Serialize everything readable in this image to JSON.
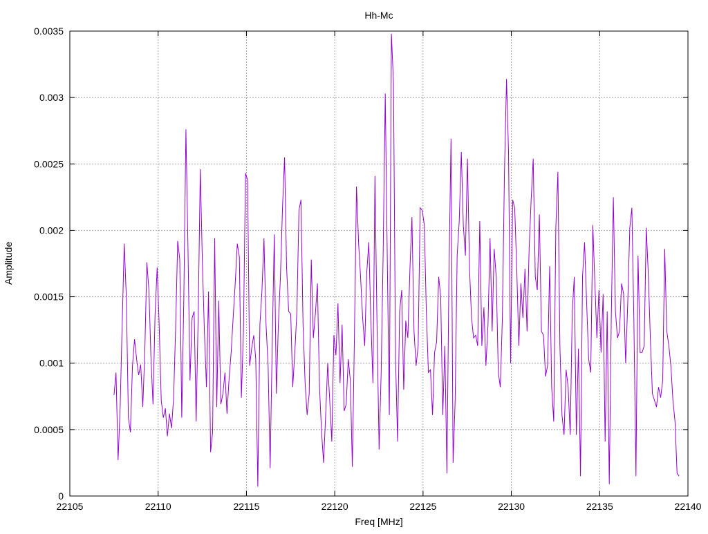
{
  "chart_data": {
    "type": "line",
    "title": "Hh-Mc",
    "xlabel": "Freq [MHz]",
    "ylabel": "Amplitude",
    "xlim": [
      22105,
      22140
    ],
    "ylim": [
      0,
      0.0035
    ],
    "xticks": [
      "22105",
      "22110",
      "22115",
      "22120",
      "22125",
      "22130",
      "22135",
      "22140"
    ],
    "xtick_values": [
      22105,
      22110,
      22115,
      22120,
      22125,
      22130,
      22135,
      22140
    ],
    "yticks": [
      "0",
      "0.0005",
      "0.001",
      "0.0015",
      "0.002",
      "0.0025",
      "0.003",
      "0.0035"
    ],
    "ytick_values": [
      0,
      0.0005,
      0.001,
      0.0015,
      0.002,
      0.0025,
      0.003,
      0.0035
    ],
    "grid": true,
    "legend": "none",
    "series": [
      {
        "name": "Hh-Mc",
        "color": "#9400d3",
        "x_range": [
          22107.5,
          22139.5
        ],
        "values": [
          0.00076,
          0.00093,
          0.00027,
          0.00067,
          0.00129,
          0.0019,
          0.0015,
          0.00059,
          0.00048,
          0.00098,
          0.00118,
          0.00103,
          0.00091,
          0.00099,
          0.00067,
          0.00108,
          0.00176,
          0.00155,
          0.00103,
          0.00069,
          0.00137,
          0.00172,
          0.00129,
          0.00072,
          0.00059,
          0.00066,
          0.00045,
          0.00062,
          0.00051,
          0.00074,
          0.00126,
          0.00192,
          0.00178,
          0.00059,
          0.0015,
          0.00276,
          0.00186,
          0.00087,
          0.00134,
          0.00139,
          0.00056,
          0.00137,
          0.00246,
          0.00176,
          0.00124,
          0.00082,
          0.00154,
          0.00033,
          0.00048,
          0.00194,
          0.00067,
          0.00147,
          0.00069,
          0.00077,
          0.00093,
          0.00062,
          0.00088,
          0.00108,
          0.00134,
          0.0016,
          0.0019,
          0.0018,
          0.00074,
          0.00124,
          0.00243,
          0.00238,
          0.00098,
          0.00111,
          0.00121,
          0.00103,
          7e-05,
          0.00129,
          0.00155,
          0.00194,
          0.00129,
          0.00098,
          0.00021,
          0.00113,
          0.00197,
          0.00077,
          0.00129,
          0.00165,
          0.00217,
          0.00255,
          0.00172,
          0.00139,
          0.00137,
          0.00082,
          0.00108,
          0.00139,
          0.00215,
          0.00223,
          0.00129,
          0.00085,
          0.00061,
          0.00077,
          0.00178,
          0.00119,
          0.00137,
          0.0016,
          0.00082,
          0.00048,
          0.00025,
          0.00061,
          0.001,
          0.00072,
          0.00041,
          0.00121,
          0.00106,
          0.00145,
          0.00085,
          0.00129,
          0.00064,
          0.00069,
          0.00103,
          0.00087,
          0.00022,
          0.00119,
          0.00233,
          0.00191,
          0.00165,
          0.00134,
          0.00113,
          0.00168,
          0.00191,
          0.00132,
          0.00085,
          0.00241,
          0.00129,
          0.00035,
          0.00093,
          0.00184,
          0.00303,
          0.00176,
          0.00061,
          0.00348,
          0.00311,
          0.00103,
          0.00041,
          0.00139,
          0.00155,
          0.0008,
          0.00132,
          0.00119,
          0.00171,
          0.0021,
          0.00124,
          0.00098,
          0.00113,
          0.00217,
          0.00215,
          0.00204,
          0.00139,
          0.00093,
          0.00095,
          0.00061,
          0.00108,
          0.00116,
          0.00165,
          0.0015,
          0.00061,
          0.00113,
          0.00017,
          0.00165,
          0.00269,
          0.00025,
          0.00072,
          0.00181,
          0.00207,
          0.00259,
          0.00204,
          0.00181,
          0.00254,
          0.00171,
          0.00134,
          0.00119,
          0.00121,
          0.00113,
          0.00207,
          0.00113,
          0.00142,
          0.00098,
          0.00129,
          0.00194,
          0.00124,
          0.00186,
          0.00165,
          0.00093,
          0.00082,
          0.00134,
          0.00243,
          0.00314,
          0.00259,
          0.001,
          0.00223,
          0.00217,
          0.00171,
          0.00113,
          0.0016,
          0.00134,
          0.00171,
          0.00124,
          0.00186,
          0.00223,
          0.00254,
          0.00165,
          0.00155,
          0.00212,
          0.00124,
          0.00121,
          0.0009,
          0.00098,
          0.00173,
          0.00082,
          0.00056,
          0.00202,
          0.00244,
          0.00113,
          0.00061,
          0.00046,
          0.00095,
          0.00082,
          0.00046,
          0.00139,
          0.00165,
          0.00046,
          0.00111,
          0.00015,
          0.00165,
          0.00191,
          0.00145,
          0.00103,
          0.00093,
          0.00204,
          0.0016,
          0.00119,
          0.00155,
          0.00108,
          0.00152,
          0.00041,
          0.00139,
          9e-05,
          0.00134,
          0.00225,
          0.00139,
          0.00119,
          0.00124,
          0.0016,
          0.00152,
          0.001,
          0.00145,
          0.00202,
          0.00217,
          0.00132,
          0.00015,
          0.00181,
          0.00108,
          0.00108,
          0.00113,
          0.00202,
          0.00168,
          0.00119,
          0.00077,
          0.00072,
          0.00067,
          0.00082,
          0.00074,
          0.00087,
          0.00186,
          0.00124,
          0.00113,
          0.00098,
          0.00072,
          0.00056,
          0.00017,
          0.00015
        ]
      }
    ]
  }
}
